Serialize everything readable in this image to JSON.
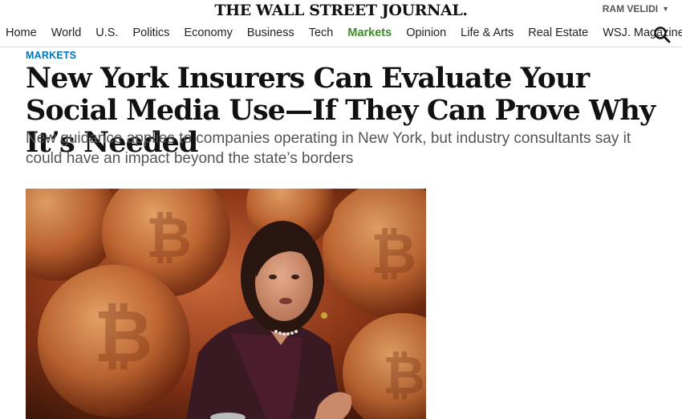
{
  "masthead": {
    "logo": "THE WALL STREET JOURNAL.",
    "user_name": "RAM VELIDI"
  },
  "nav": {
    "items": [
      {
        "label": "Home",
        "active": false
      },
      {
        "label": "World",
        "active": false
      },
      {
        "label": "U.S.",
        "active": false
      },
      {
        "label": "Politics",
        "active": false
      },
      {
        "label": "Economy",
        "active": false
      },
      {
        "label": "Business",
        "active": false
      },
      {
        "label": "Tech",
        "active": false
      },
      {
        "label": "Markets",
        "active": true
      },
      {
        "label": "Opinion",
        "active": false
      },
      {
        "label": "Life & Arts",
        "active": false
      },
      {
        "label": "Real Estate",
        "active": false
      },
      {
        "label": "WSJ. Magazine",
        "active": false
      }
    ],
    "search_icon": "search-icon"
  },
  "article": {
    "section": "MARKETS",
    "headline": "New York Insurers Can Evaluate Your Social Media Use—If They Can Prove Why It’s Needed",
    "dek": "New guidance applies to companies operating in New York, but industry consultants say it could have an impact beyond the state’s borders"
  },
  "colors": {
    "accent_green": "#3c8c2a",
    "section_blue": "#0274b6",
    "dek_gray": "#555555"
  }
}
